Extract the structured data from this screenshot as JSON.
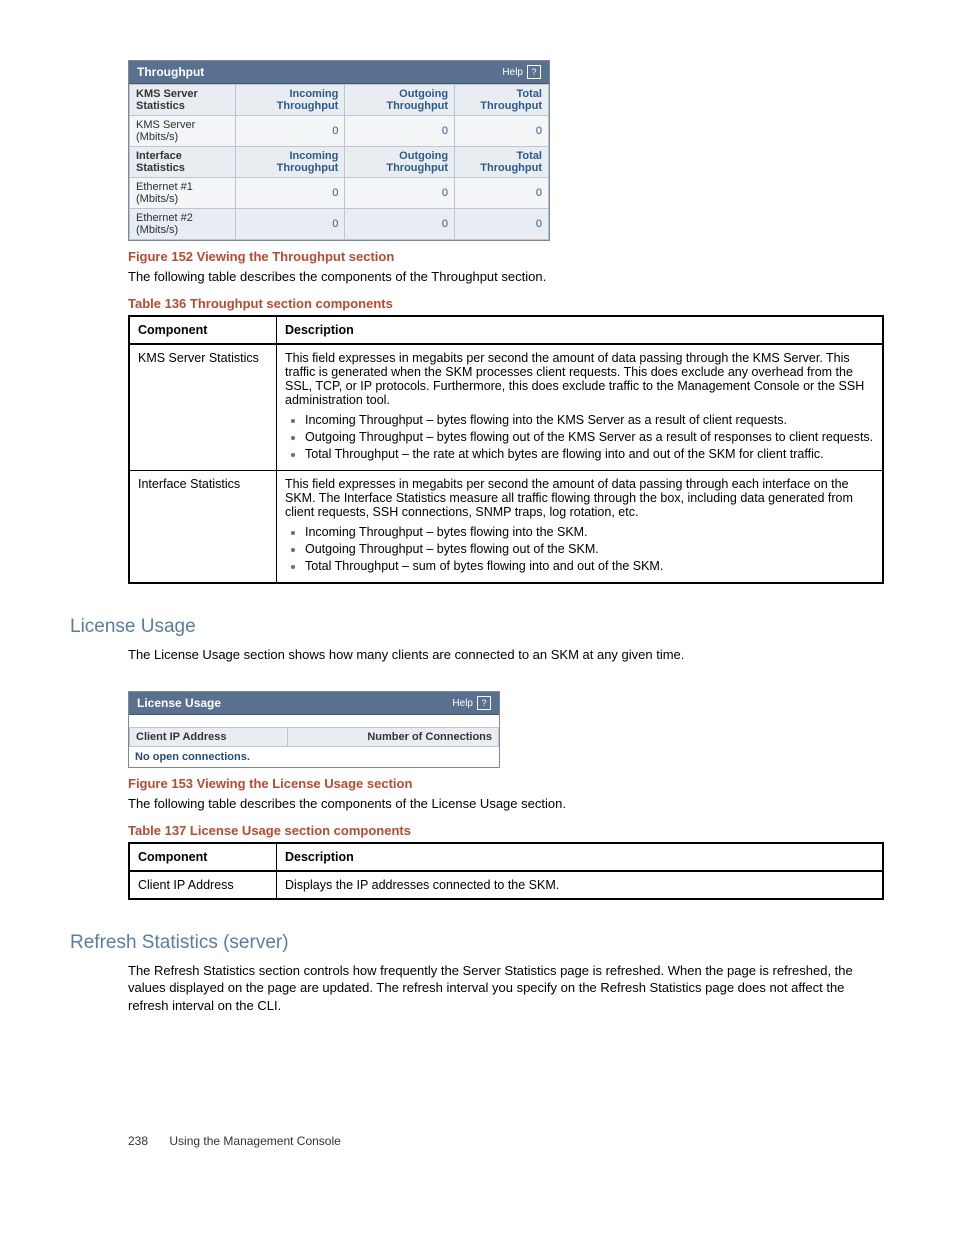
{
  "throughput_panel": {
    "title": "Throughput",
    "help": "Help",
    "rows": [
      {
        "label": "KMS Server Statistics",
        "c1": "Incoming Throughput",
        "c2": "Outgoing Throughput",
        "c3": "Total Throughput",
        "head": true
      },
      {
        "label": "KMS Server (Mbits/s)",
        "c1": "0",
        "c2": "0",
        "c3": "0"
      },
      {
        "label": "Interface Statistics",
        "c1": "Incoming Throughput",
        "c2": "Outgoing Throughput",
        "c3": "Total Throughput",
        "head": true
      },
      {
        "label": "Ethernet #1 (Mbits/s)",
        "c1": "0",
        "c2": "0",
        "c3": "0"
      },
      {
        "label": "Ethernet #2 (Mbits/s)",
        "c1": "0",
        "c2": "0",
        "c3": "0"
      }
    ]
  },
  "fig152": "Figure 152 Viewing the Throughput section",
  "fig152_text": "The following table describes the components of the Throughput section.",
  "table136_caption": "Table 136 Throughput section components",
  "table136": {
    "headers": {
      "c0": "Component",
      "c1": "Description"
    },
    "rows": [
      {
        "component": "KMS Server Statistics",
        "desc_intro": "This field expresses in megabits per second the amount of data passing through the KMS Server. This traffic is generated when the SKM processes client requests. This does exclude any overhead from the SSL, TCP, or IP protocols. Furthermore, this does exclude traffic to the Management Console or the SSH administration tool.",
        "bullets": [
          "Incoming Throughput – bytes flowing into the KMS Server as a result of client requests.",
          "Outgoing Throughput – bytes flowing out of the KMS Server as a result of responses to client requests.",
          "Total Throughput – the rate at which bytes are flowing into and out of the SKM for client traffic."
        ]
      },
      {
        "component": "Interface Statistics",
        "desc_intro": "This field expresses in megabits per second the amount of data passing through each interface on the SKM. The Interface Statistics measure all traffic flowing through the box, including data generated from client requests, SSH connections, SNMP traps, log rotation, etc.",
        "bullets": [
          "Incoming Throughput – bytes flowing into the SKM.",
          "Outgoing Throughput – bytes flowing out of the SKM.",
          "Total Throughput – sum of bytes flowing into and out of the SKM."
        ]
      }
    ]
  },
  "license_heading": "License Usage",
  "license_intro": "The License Usage section shows how many clients are connected to an SKM at any given time.",
  "license_panel": {
    "title": "License Usage",
    "help": "Help",
    "col0": "Client IP Address",
    "col1": "Number of Connections",
    "empty": "No open connections."
  },
  "fig153": "Figure 153 Viewing the License Usage section",
  "fig153_text": "The following table describes the components of the License Usage section.",
  "table137_caption": "Table 137 License Usage section components",
  "table137": {
    "headers": {
      "c0": "Component",
      "c1": "Description"
    },
    "rows": [
      {
        "component": "Client IP Address",
        "desc": "Displays the IP addresses connected to the SKM."
      }
    ]
  },
  "refresh_heading": "Refresh Statistics (server)",
  "refresh_text": "The Refresh Statistics section controls how frequently the Server Statistics page is refreshed. When the page is refreshed, the values displayed on the page are updated. The refresh interval you specify on the Refresh Statistics page does not affect the refresh interval on the CLI.",
  "footer": {
    "page": "238",
    "title": "Using the Management Console"
  }
}
